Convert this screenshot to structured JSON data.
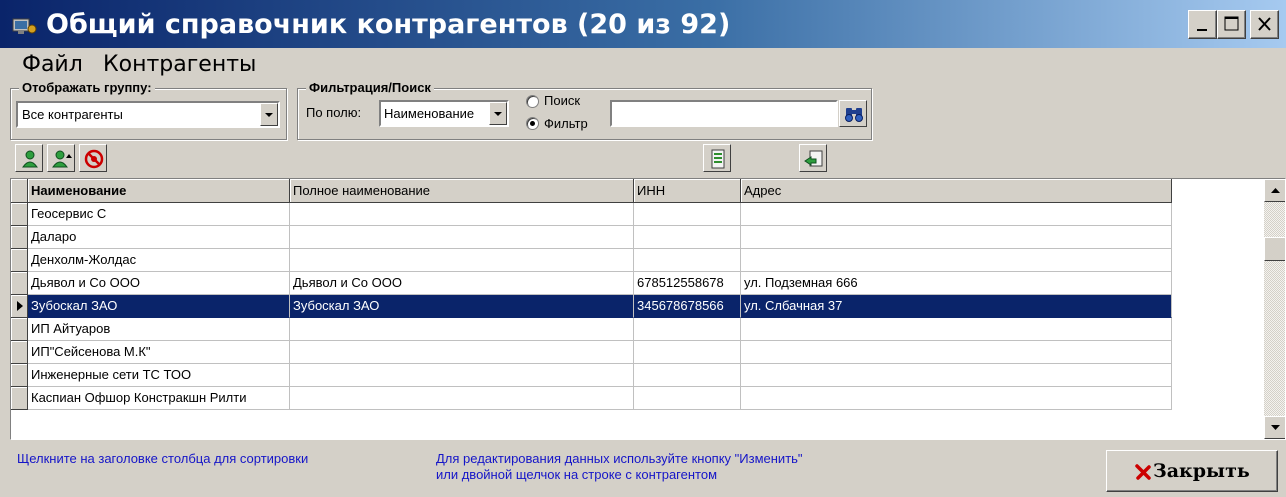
{
  "window": {
    "title": "Общий справочник контрагентов (20 из 92)",
    "controls": {
      "minimize": "_",
      "maximize": "□",
      "close": "×"
    }
  },
  "menu": [
    "Файл",
    "Контрагенты"
  ],
  "group_filter": {
    "title": "Отображать группу:",
    "selected": "Все контрагенты"
  },
  "search_filter": {
    "title": "Фильтрация/Поиск",
    "field_label": "По полю:",
    "field_selected": "Наименование",
    "mode_search": "Поиск",
    "mode_filter": "Фильтр",
    "mode_selected": "Фильтр",
    "query": ""
  },
  "toolbar_icons": [
    "add-user-icon",
    "edit-user-icon",
    "delete-icon",
    "report-icon",
    "export-icon"
  ],
  "table": {
    "columns": [
      "Наименование",
      "Полное наименование",
      "ИНН",
      "Адрес"
    ],
    "rows": [
      [
        "Геосервис С",
        "",
        "",
        ""
      ],
      [
        "Даларо",
        "",
        "",
        ""
      ],
      [
        "Денхолм-Жолдас",
        "",
        "",
        ""
      ],
      [
        "Дьявол и Со ООО",
        "Дьявол и Со ООО",
        "678512558678",
        "ул. Подземная 666"
      ],
      [
        "Зубоскал ЗАО",
        "Зубоскал ЗАО",
        "345678678566",
        "ул. Слбачная 37"
      ],
      [
        "ИП Айтуаров",
        "",
        "",
        ""
      ],
      [
        "ИП\"Сейсенова М.К\"",
        "",
        "",
        ""
      ],
      [
        "Инженерные сети ТС ТОО",
        "",
        "",
        ""
      ],
      [
        "Каспиан Офшор Констракшн Рилти",
        "",
        "",
        ""
      ]
    ],
    "selected_row": 4
  },
  "footer": {
    "sort_hint": "Щелкните на заголовке столбца для сортировки",
    "edit_hint_line1": "Для редактирования данных используйте кнопку \"Изменить\"",
    "edit_hint_line2": "или двойной щелчок на строке с контрагентом",
    "close_button": "Закрыть"
  },
  "colors": {
    "title_gradient_start": "#0a246a",
    "title_gradient_end": "#a6caf0",
    "selection": "#0a246a",
    "hint_text": "#1515c8",
    "close_icon": "#cc0000"
  }
}
